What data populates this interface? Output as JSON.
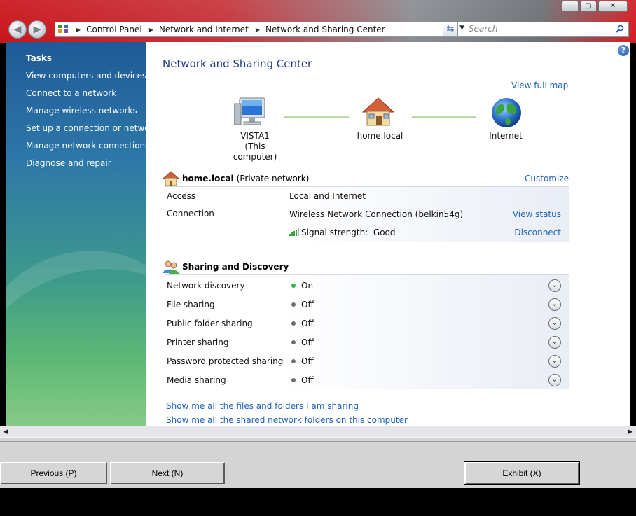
{
  "window": {
    "controls": {
      "minimize": "—",
      "maximize": "▢",
      "close": "✕"
    }
  },
  "navbar": {
    "breadcrumbs": [
      "Control Panel",
      "Network and Internet",
      "Network and Sharing Center"
    ],
    "search_placeholder": "Search"
  },
  "sidebar": {
    "title": "Tasks",
    "items": [
      "View computers and devices",
      "Connect to a network",
      "Manage wireless networks",
      "Set up a connection or network",
      "Manage network connections",
      "Diagnose and repair"
    ]
  },
  "main": {
    "title": "Network and Sharing Center",
    "view_full_map": "View full map",
    "help": "?",
    "map": {
      "computer_name": "VISTA1",
      "computer_sub": "(This computer)",
      "network_name": "home.local",
      "internet": "Internet"
    },
    "network": {
      "name": "home.local",
      "type": "(Private network)",
      "customize": "Customize",
      "rows": [
        {
          "label": "Access",
          "value": "Local and Internet",
          "action": ""
        },
        {
          "label": "Connection",
          "value": "Wireless Network Connection (belkin54g)",
          "action": "View status"
        }
      ],
      "signal_label": "Signal strength:",
      "signal_value": "Good",
      "disconnect": "Disconnect"
    },
    "sharing": {
      "title": "Sharing and Discovery",
      "items": [
        {
          "label": "Network discovery",
          "state": "On"
        },
        {
          "label": "File sharing",
          "state": "Off"
        },
        {
          "label": "Public folder sharing",
          "state": "Off"
        },
        {
          "label": "Printer sharing",
          "state": "Off"
        },
        {
          "label": "Password protected sharing",
          "state": "Off"
        },
        {
          "label": "Media sharing",
          "state": "Off"
        }
      ]
    },
    "links": [
      "Show me all the files and folders I am sharing",
      "Show me all the shared network folders on this computer"
    ]
  },
  "exam": {
    "previous": "Previous (P)",
    "next": "Next (N)",
    "exhibit": "Exhibit (X)"
  },
  "colors": {
    "status_on": "#2bb24c",
    "status_off": "#6d6d6d",
    "link": "#1f62b6",
    "title": "#1e3c87"
  }
}
